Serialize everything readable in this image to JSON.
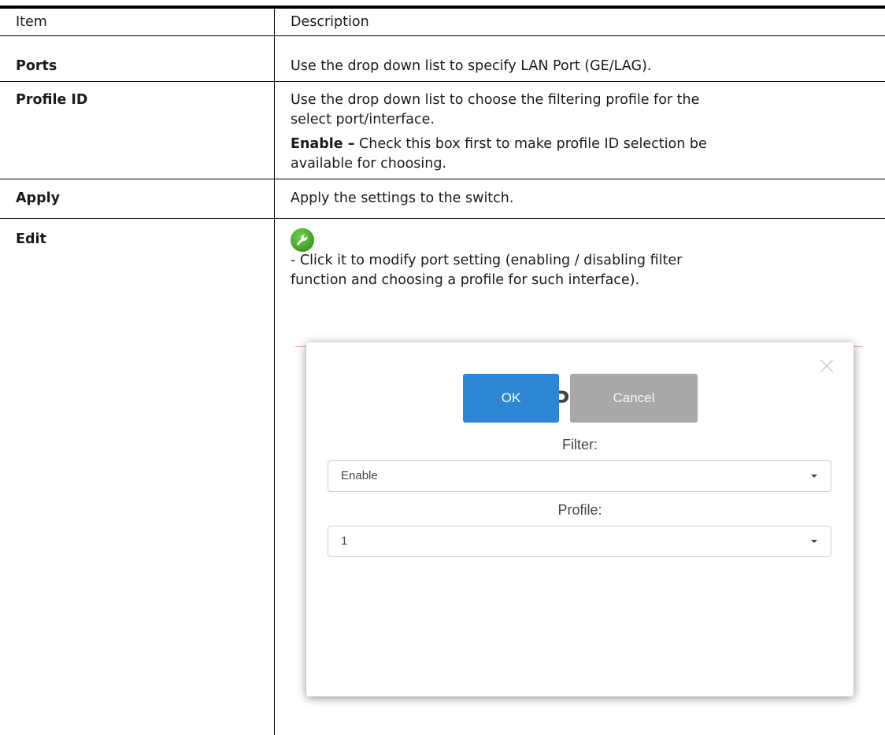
{
  "table": {
    "header": {
      "item": "Item",
      "description": "Description"
    },
    "rows": {
      "ports": {
        "item": "Ports",
        "desc": "Use the drop down list to specify LAN Port (GE/LAG)."
      },
      "profile_id": {
        "item": "Profile ID",
        "desc_line1": "Use the drop down list to choose the filtering profile for the",
        "desc_line2": "select port/interface.",
        "enable_bold": "Enable –",
        "enable_line1": " Check this box first to make profile ID selection be",
        "enable_line2": "available for choosing."
      },
      "apply": {
        "item": "Apply",
        "desc": "Apply the settings to the switch."
      },
      "edit": {
        "item": "Edit",
        "desc_line1": "- Click it to modify port setting (enabling / disabling filter",
        "desc_line2": "function and choosing a profile for such interface)."
      }
    }
  },
  "icons": {
    "edit": "wrench-icon",
    "close": "close-icon"
  },
  "modal": {
    "title": "Edit Port GE1",
    "filter_label": "Filter:",
    "filter_value": "Enable",
    "profile_label": "Profile:",
    "profile_value": "1",
    "ok_label": "OK",
    "cancel_label": "Cancel"
  },
  "colors": {
    "ok_button": "#2d87d5",
    "cancel_button": "#a8a8a8",
    "icon_green": "#3a9a1e"
  }
}
